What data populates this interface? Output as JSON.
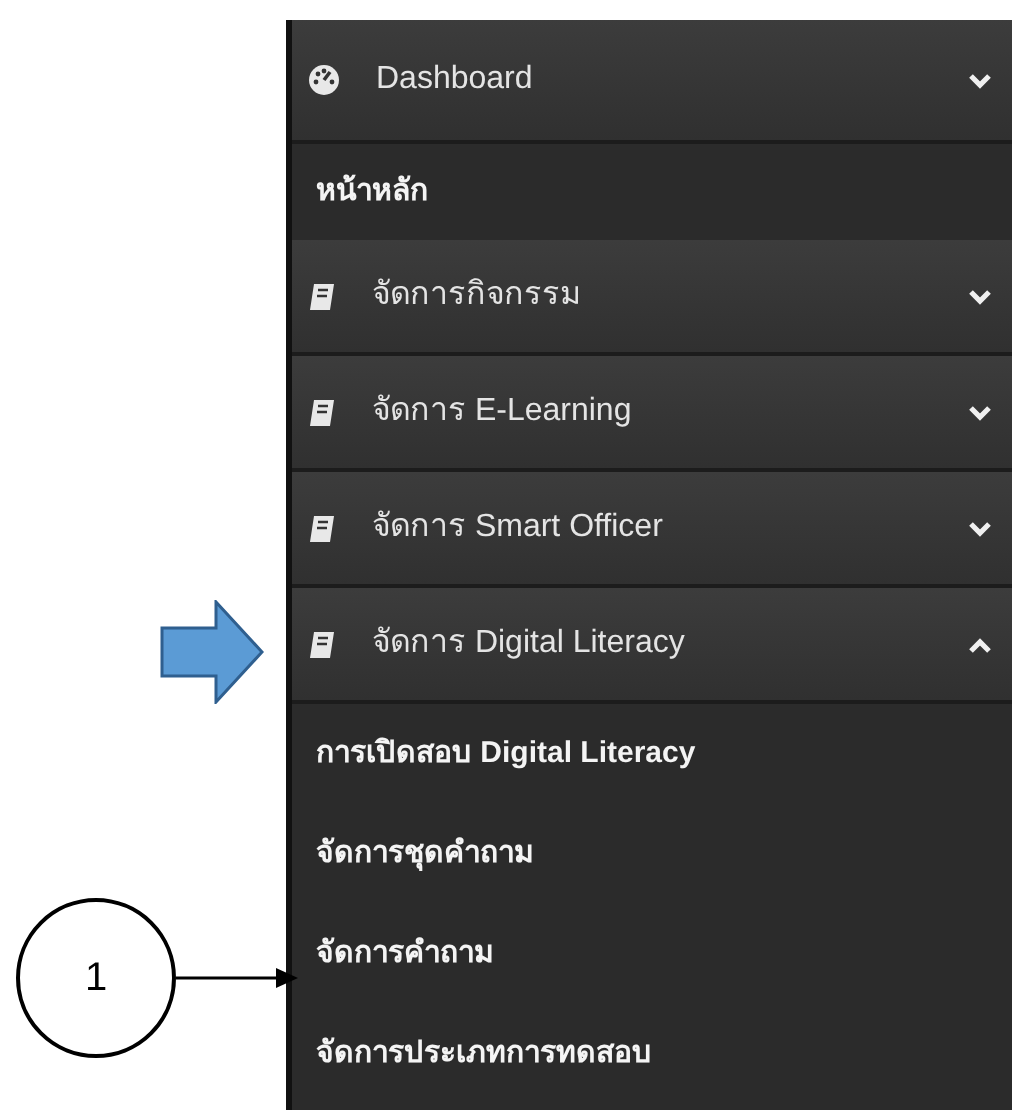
{
  "menu": [
    {
      "label": "Dashboard",
      "kind": "dashboard",
      "expanded": false,
      "children": [
        "หน้าหลัก"
      ]
    },
    {
      "label": "จัดการกิจกรรม",
      "kind": "book",
      "expanded": false
    },
    {
      "label": "จัดการ E-Learning",
      "kind": "book",
      "expanded": false
    },
    {
      "label": "จัดการ Smart Officer",
      "kind": "book",
      "expanded": false
    },
    {
      "label": "จัดการ Digital Literacy",
      "kind": "book",
      "expanded": true,
      "children": [
        "การเปิดสอบ Digital Literacy",
        "จัดการชุดคำถาม",
        "จัดการคำถาม",
        "จัดการประเภทการทดสอบ"
      ]
    }
  ],
  "callout": {
    "label": "1"
  }
}
